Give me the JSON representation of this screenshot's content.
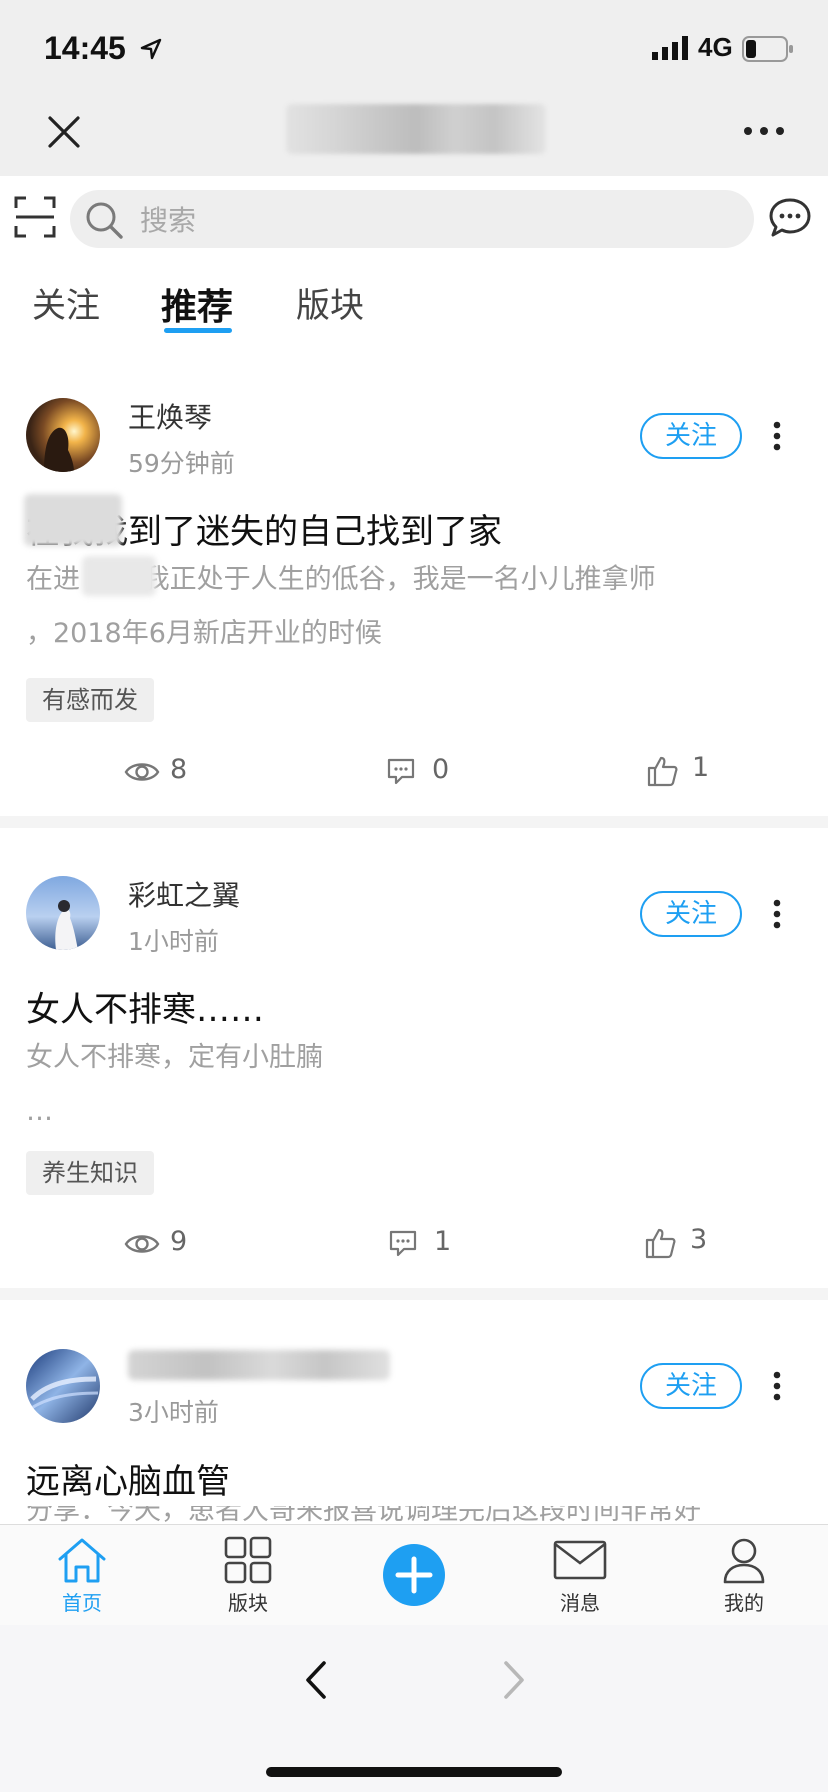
{
  "status_bar": {
    "time": "14:45",
    "network": "4G"
  },
  "search": {
    "placeholder": "搜索"
  },
  "tabs": [
    {
      "label": "关注",
      "active": false
    },
    {
      "label": "推荐",
      "active": true
    },
    {
      "label": "版块",
      "active": false
    }
  ],
  "posts": [
    {
      "author": "王焕琴",
      "time": "59分钟前",
      "follow_label": "关注",
      "title": "在我找到了迷失的自己找到了家",
      "excerpt_line1": "在进      之前我正处于人生的低谷，我是一名小儿推拿师",
      "excerpt_line2": "，2018年6月新店开业的时候",
      "tag": "有感而发",
      "views": "8",
      "comments": "0",
      "likes": "1"
    },
    {
      "author": "彩虹之翼",
      "time": "1小时前",
      "follow_label": "关注",
      "title": "女人不排寒……",
      "excerpt_line1": "女人不排寒，定有小肚腩",
      "excerpt_line2": "…",
      "tag": "养生知识",
      "views": "9",
      "comments": "1",
      "likes": "3"
    },
    {
      "author": "",
      "time": "3小时前",
      "follow_label": "关注",
      "title": "远离心脑血管",
      "excerpt_line1": "分享：今天，患者大哥来报喜说调理完后这段时间非常好"
    }
  ],
  "tabbar": {
    "home": "首页",
    "sections": "版块",
    "messages": "消息",
    "me": "我的"
  },
  "colors": {
    "accent": "#1e9ff2",
    "muted": "#a0a0a0"
  }
}
